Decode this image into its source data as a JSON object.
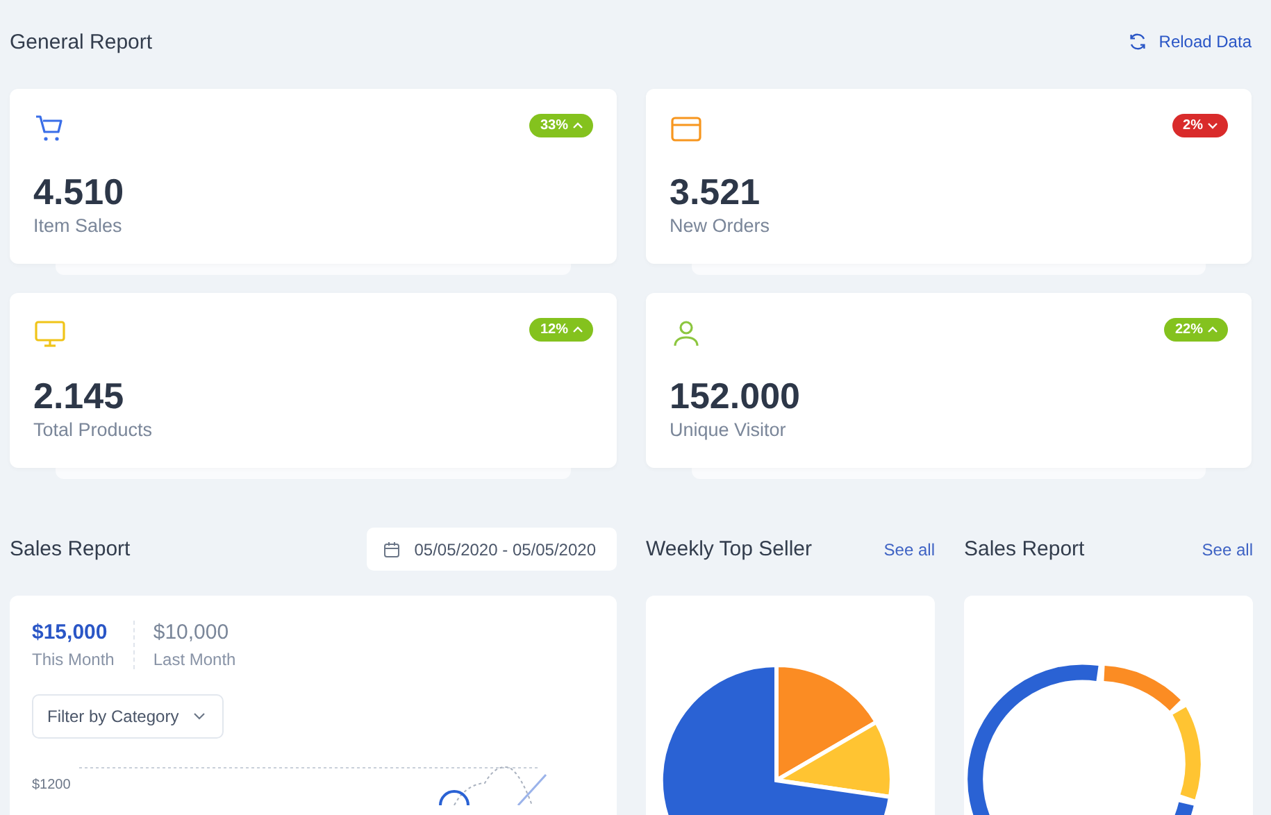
{
  "header": {
    "title": "General Report",
    "reload": {
      "label": "Reload Data"
    }
  },
  "stats": [
    {
      "kind": "cart",
      "value": "4.510",
      "label": "Item Sales",
      "change": "33%",
      "rising": true
    },
    {
      "kind": "card",
      "value": "3.521",
      "label": "New Orders",
      "change": "2%",
      "rising": false
    },
    {
      "kind": "monitor",
      "value": "2.145",
      "label": "Total Products",
      "change": "12%",
      "rising": true
    },
    {
      "kind": "user",
      "value": "152.000",
      "label": "Unique Visitor",
      "change": "22%",
      "rising": true
    }
  ],
  "sales_report": {
    "title": "Sales Report",
    "date_range": "05/05/2020 - 05/05/2020",
    "totals": [
      {
        "amount": "$15,000",
        "label": "This Month",
        "selected": true
      },
      {
        "amount": "$10,000",
        "label": "Last Month",
        "selected": false
      }
    ],
    "filter": "Filter by Category",
    "y_tick": "$1200"
  },
  "side_panels": [
    {
      "title": "Weekly Top Seller",
      "link": "See all",
      "kind": "pie"
    },
    {
      "title": "Sales Report",
      "link": "See all",
      "kind": "donut"
    }
  ]
}
